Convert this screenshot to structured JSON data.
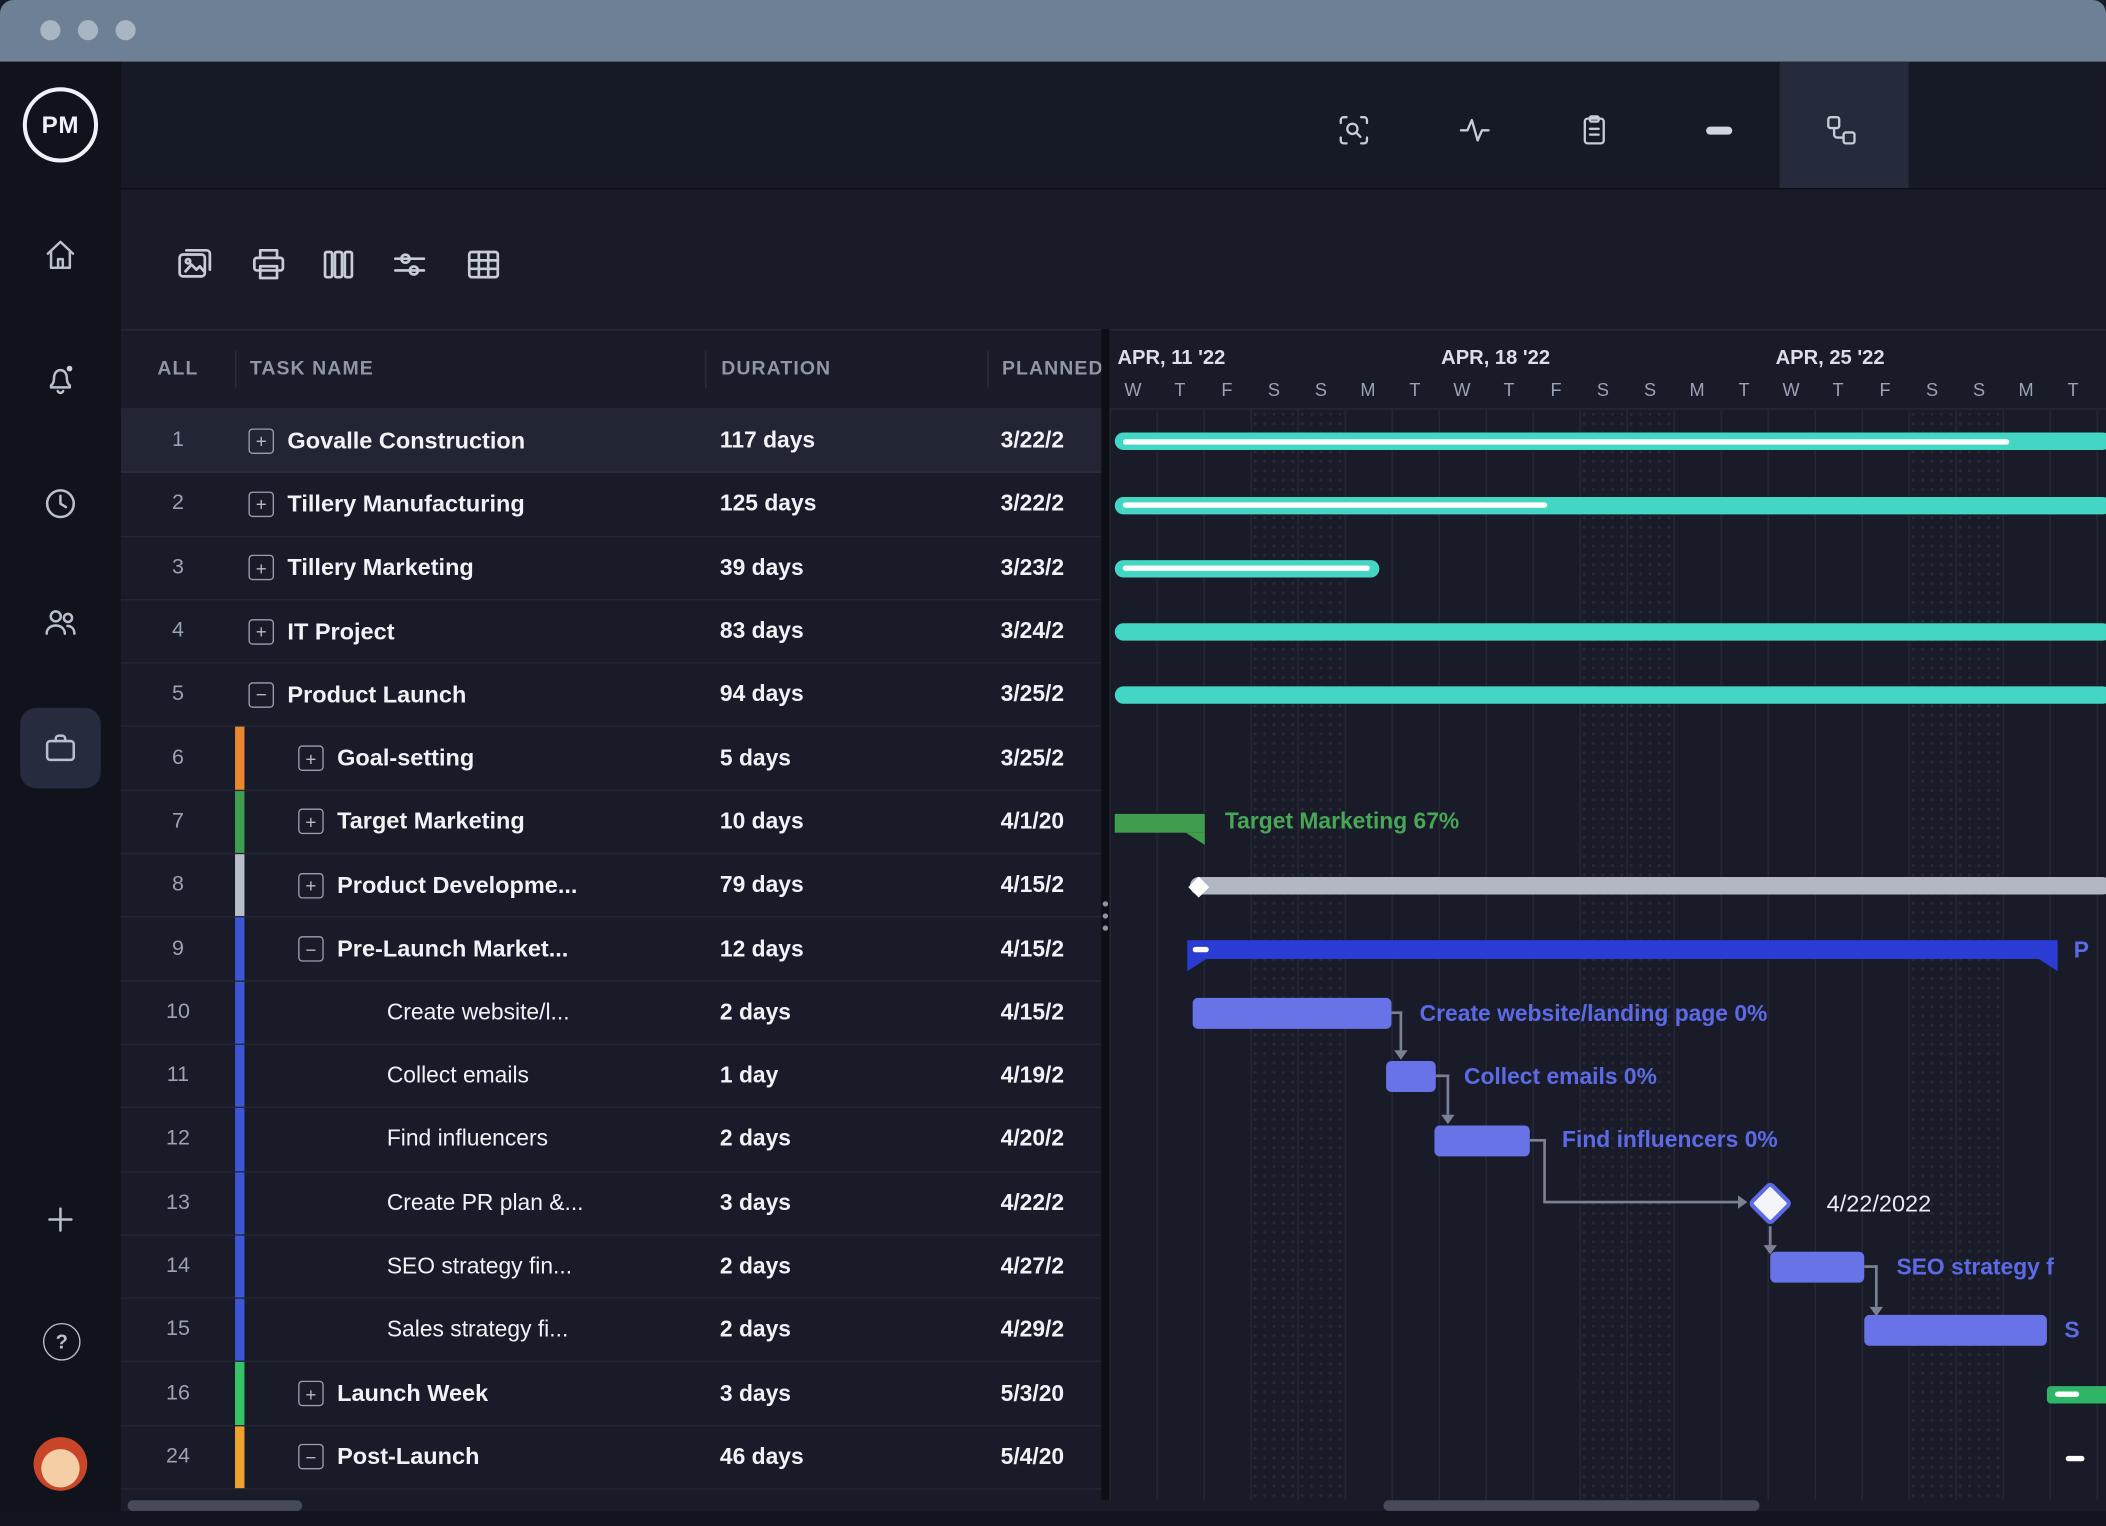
{
  "brand": {
    "logo": "PM"
  },
  "icons": {
    "topbar": [
      "scan-search-icon",
      "activity-icon",
      "clipboard-icon",
      "bar-icon",
      "workflow-icon"
    ],
    "topbar_active": "workflow-icon",
    "toolbar": [
      "projects-icon",
      "print-icon",
      "columns-icon",
      "filter-icon",
      "table-icon"
    ],
    "sidebar": [
      "home-icon",
      "bell-icon",
      "clock-icon",
      "team-icon",
      "portfolio-icon",
      "plus-icon",
      "help-icon",
      "avatar"
    ],
    "sidebar_active": "portfolio-icon"
  },
  "palette": {
    "teal": "#43d6c5",
    "summary_blue": "#2b3cd4",
    "task_purple": "#6773e6",
    "label_purple": "#5d6ae8",
    "green_dark": "#3f9e4d",
    "green_bright": "#2eb567",
    "orange": "#e8872e",
    "gray": "#b2b8c3",
    "bg": "#191c28"
  },
  "table": {
    "headers": {
      "all": "ALL",
      "task_name": "TASK NAME",
      "duration": "DURATION",
      "planned": "PLANNED"
    },
    "rows": [
      {
        "num": "1",
        "name": "Govalle Construction",
        "duration": "117 days",
        "planned": "3/22/2"
      },
      {
        "num": "2",
        "name": "Tillery Manufacturing",
        "duration": "125 days",
        "planned": "3/22/2"
      },
      {
        "num": "3",
        "name": "Tillery Marketing",
        "duration": "39 days",
        "planned": "3/23/2"
      },
      {
        "num": "4",
        "name": "IT Project",
        "duration": "83 days",
        "planned": "3/24/2"
      },
      {
        "num": "5",
        "name": "Product Launch",
        "duration": "94 days",
        "planned": "3/25/2"
      },
      {
        "num": "6",
        "name": "Goal-setting",
        "duration": "5 days",
        "planned": "3/25/2"
      },
      {
        "num": "7",
        "name": "Target Marketing",
        "duration": "10 days",
        "planned": "4/1/20"
      },
      {
        "num": "8",
        "name": "Product Developme...",
        "duration": "79 days",
        "planned": "4/15/2"
      },
      {
        "num": "9",
        "name": "Pre-Launch Market...",
        "duration": "12 days",
        "planned": "4/15/2"
      },
      {
        "num": "10",
        "name": "Create website/l...",
        "duration": "2 days",
        "planned": "4/15/2"
      },
      {
        "num": "11",
        "name": "Collect emails",
        "duration": "1 day",
        "planned": "4/19/2"
      },
      {
        "num": "12",
        "name": "Find influencers",
        "duration": "2 days",
        "planned": "4/20/2"
      },
      {
        "num": "13",
        "name": "Create PR plan &...",
        "duration": "3 days",
        "planned": "4/22/2"
      },
      {
        "num": "14",
        "name": "SEO strategy fin...",
        "duration": "2 days",
        "planned": "4/27/2"
      },
      {
        "num": "15",
        "name": "Sales strategy fi...",
        "duration": "2 days",
        "planned": "4/29/2"
      },
      {
        "num": "16",
        "name": "Launch Week",
        "duration": "3 days",
        "planned": "5/3/20"
      },
      {
        "num": "24",
        "name": "Post-Launch",
        "duration": "46 days",
        "planned": "5/4/20"
      }
    ]
  },
  "timeline": {
    "weeks": [
      "APR, 11 '22",
      "APR, 18 '22",
      "APR, 25 '22"
    ],
    "days": [
      "W",
      "T",
      "F",
      "S",
      "S",
      "M",
      "T",
      "W",
      "T",
      "F",
      "S",
      "S",
      "M",
      "T",
      "W",
      "T",
      "F",
      "S",
      "S",
      "M",
      "T"
    ]
  },
  "gantt": {
    "labels": {
      "target_marketing": "Target Marketing  67%",
      "pre_launch": "P",
      "create_website": "Create website/landing page  0%",
      "collect_emails": "Collect emails  0%",
      "find_influencers": "Find influencers  0%",
      "milestone_date": "4/22/2022",
      "seo": "SEO strategy f",
      "sales": "S"
    }
  }
}
